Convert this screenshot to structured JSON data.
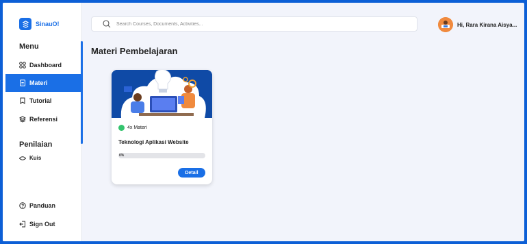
{
  "app": {
    "name": "SinauO!"
  },
  "sidebar": {
    "menu_heading": "Menu",
    "items": [
      {
        "label": "Dashboard",
        "icon": "grid-icon",
        "active": false
      },
      {
        "label": "Materi",
        "icon": "document-icon",
        "active": true
      },
      {
        "label": "Tutorial",
        "icon": "bookmark-icon",
        "active": false
      },
      {
        "label": "Referensi",
        "icon": "layers-icon",
        "active": false
      }
    ],
    "assessment_heading": "Penilaian",
    "assessment_items": [
      {
        "label": "Kuis",
        "icon": "eye-icon"
      }
    ],
    "bottom_items": [
      {
        "label": "Panduan",
        "icon": "help-icon"
      },
      {
        "label": "Sign Out",
        "icon": "sign-out-icon"
      }
    ]
  },
  "header": {
    "search_placeholder": "Search Courses, Documents, Activities...",
    "user_greeting": "Hi, Rara Kirana Aisya..."
  },
  "main": {
    "title": "Materi Pembelajaran",
    "cards": [
      {
        "materi_count": "4x Materi",
        "title": "Teknologi Aplikasi Website",
        "progress_label": "0%",
        "progress": 0,
        "button_label": "Detail"
      }
    ]
  },
  "colors": {
    "primary": "#1a6fe6",
    "background": "#f2f4fb",
    "accent_green": "#34c46e",
    "avatar": "#f08a3e"
  }
}
